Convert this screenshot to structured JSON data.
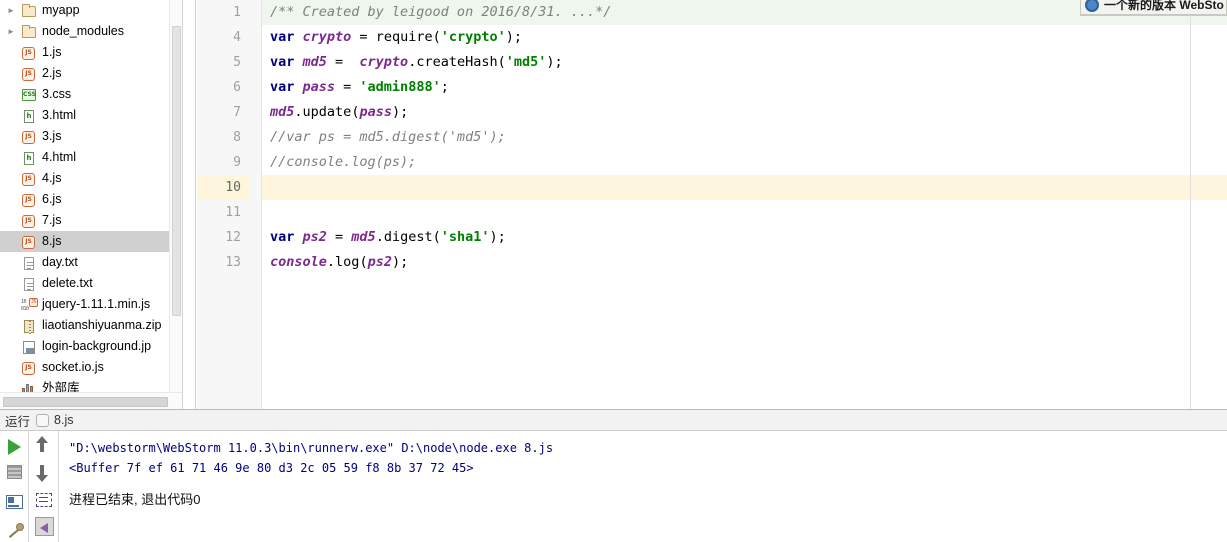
{
  "project_tree": {
    "name": "project-file-tree",
    "items": [
      {
        "label": "myapp",
        "icon": "folder-icon",
        "type": "folder",
        "arrow": "collapsed",
        "selected": false
      },
      {
        "label": "node_modules",
        "icon": "folder-icon",
        "type": "folder",
        "arrow": "collapsed",
        "selected": false
      },
      {
        "label": "1.js",
        "icon": "js-file-icon",
        "type": "js",
        "arrow": "none",
        "selected": false
      },
      {
        "label": "2.js",
        "icon": "js-file-icon",
        "type": "js",
        "arrow": "none",
        "selected": false
      },
      {
        "label": "3.css",
        "icon": "css-file-icon",
        "type": "css",
        "arrow": "none",
        "selected": false
      },
      {
        "label": "3.html",
        "icon": "html-file-icon",
        "type": "html",
        "arrow": "none",
        "selected": false
      },
      {
        "label": "3.js",
        "icon": "js-file-icon",
        "type": "js",
        "arrow": "none",
        "selected": false
      },
      {
        "label": "4.html",
        "icon": "html-file-icon",
        "type": "html",
        "arrow": "none",
        "selected": false
      },
      {
        "label": "4.js",
        "icon": "js-file-icon",
        "type": "js",
        "arrow": "none",
        "selected": false
      },
      {
        "label": "6.js",
        "icon": "js-file-icon",
        "type": "js",
        "arrow": "none",
        "selected": false
      },
      {
        "label": "7.js",
        "icon": "js-file-icon",
        "type": "js",
        "arrow": "none",
        "selected": false
      },
      {
        "label": "8.js",
        "icon": "js-file-icon",
        "type": "js",
        "arrow": "none",
        "selected": true
      },
      {
        "label": "day.txt",
        "icon": "text-file-icon",
        "type": "txt",
        "arrow": "none",
        "selected": false
      },
      {
        "label": "delete.txt",
        "icon": "text-file-icon",
        "type": "txt",
        "arrow": "none",
        "selected": false
      },
      {
        "label": "jquery-1.11.1.min.js",
        "icon": "minified-js-file-icon",
        "type": "minjs",
        "arrow": "none",
        "selected": false
      },
      {
        "label": "liaotianshiyuanma.zip",
        "icon": "zip-file-icon",
        "type": "zip",
        "arrow": "none",
        "selected": false
      },
      {
        "label": "login-background.jp",
        "icon": "image-file-icon",
        "type": "img",
        "arrow": "none",
        "selected": false
      },
      {
        "label": "socket.io.js",
        "icon": "js-file-icon",
        "type": "js",
        "arrow": "none",
        "selected": false
      },
      {
        "label": "外部库",
        "icon": "library-icon",
        "type": "lib",
        "arrow": "none",
        "selected": false
      }
    ]
  },
  "editor": {
    "name": "code-editor",
    "gutter_numbers": [
      "1",
      "4",
      "5",
      "6",
      "7",
      "8",
      "9",
      "10",
      "11",
      "12",
      "13"
    ],
    "caret_line": "10",
    "lines": [
      {
        "number": "1",
        "highlight": "comment",
        "fold": "plus",
        "tokens": [
          {
            "t": "/** Created by leigood on 2016/8/31. ...*/",
            "c": "comment"
          }
        ]
      },
      {
        "number": "4",
        "highlight": "none",
        "fold": "none",
        "tokens": [
          {
            "t": "var ",
            "c": "kw"
          },
          {
            "t": "crypto",
            "c": "localv"
          },
          {
            "t": " = ",
            "c": "plain"
          },
          {
            "t": "require",
            "c": "fn"
          },
          {
            "t": "(",
            "c": "plain"
          },
          {
            "t": "'crypto'",
            "c": "str"
          },
          {
            "t": ");",
            "c": "plain"
          }
        ]
      },
      {
        "number": "5",
        "highlight": "none",
        "fold": "none",
        "tokens": [
          {
            "t": "var ",
            "c": "kw"
          },
          {
            "t": "md5",
            "c": "localv"
          },
          {
            "t": " =  ",
            "c": "plain"
          },
          {
            "t": "crypto",
            "c": "localv"
          },
          {
            "t": ".",
            "c": "plain"
          },
          {
            "t": "createHash",
            "c": "fn"
          },
          {
            "t": "(",
            "c": "plain"
          },
          {
            "t": "'md5'",
            "c": "str"
          },
          {
            "t": ");",
            "c": "plain"
          }
        ]
      },
      {
        "number": "6",
        "highlight": "none",
        "fold": "none",
        "tokens": [
          {
            "t": "var ",
            "c": "kw"
          },
          {
            "t": "pass",
            "c": "localv"
          },
          {
            "t": " = ",
            "c": "plain"
          },
          {
            "t": "'admin888'",
            "c": "str"
          },
          {
            "t": ";",
            "c": "plain"
          }
        ]
      },
      {
        "number": "7",
        "highlight": "none",
        "fold": "none",
        "tokens": [
          {
            "t": "md5",
            "c": "localv"
          },
          {
            "t": ".",
            "c": "plain"
          },
          {
            "t": "update",
            "c": "fn"
          },
          {
            "t": "(",
            "c": "plain"
          },
          {
            "t": "pass",
            "c": "localv"
          },
          {
            "t": ");",
            "c": "plain"
          }
        ]
      },
      {
        "number": "8",
        "highlight": "none",
        "fold": "minus",
        "tokens": [
          {
            "t": "//var ps = md5.digest('md5');",
            "c": "comment"
          }
        ]
      },
      {
        "number": "9",
        "highlight": "none",
        "fold": "minus",
        "tokens": [
          {
            "t": "//console.log(ps);",
            "c": "comment"
          }
        ]
      },
      {
        "number": "10",
        "highlight": "caret",
        "fold": "none",
        "tokens": []
      },
      {
        "number": "11",
        "highlight": "none",
        "fold": "none",
        "tokens": []
      },
      {
        "number": "12",
        "highlight": "none",
        "fold": "none",
        "tokens": [
          {
            "t": "var ",
            "c": "kw"
          },
          {
            "t": "ps2",
            "c": "localv"
          },
          {
            "t": " = ",
            "c": "plain"
          },
          {
            "t": "md5",
            "c": "localv"
          },
          {
            "t": ".",
            "c": "plain"
          },
          {
            "t": "digest",
            "c": "fn"
          },
          {
            "t": "(",
            "c": "plain"
          },
          {
            "t": "'sha1'",
            "c": "str"
          },
          {
            "t": ");",
            "c": "plain"
          }
        ]
      },
      {
        "number": "13",
        "highlight": "none",
        "fold": "none",
        "tokens": [
          {
            "t": "console",
            "c": "localv"
          },
          {
            "t": ".",
            "c": "plain"
          },
          {
            "t": "log",
            "c": "fn"
          },
          {
            "t": "(",
            "c": "plain"
          },
          {
            "t": "ps2",
            "c": "localv"
          },
          {
            "t": ");",
            "c": "plain"
          }
        ]
      }
    ]
  },
  "notification": {
    "icon": "update-info-icon",
    "text": "一个新的版本 WebSto"
  },
  "run_panel": {
    "tab_label": "运行",
    "tab_icon": "run-config-icon",
    "tab_file": "8.js",
    "toolbar_left": [
      {
        "name": "rerun-button",
        "icon": "run-icon",
        "label": ""
      },
      {
        "name": "stop-button",
        "icon": "stop-icon",
        "label": ""
      },
      {
        "name": "show-console-button",
        "icon": "console-icon",
        "label": ""
      },
      {
        "name": "pin-tab-button",
        "icon": "pin-icon",
        "label": ""
      }
    ],
    "toolbar_mid": [
      {
        "name": "up-stack-trace-button",
        "icon": "arrow-up-icon",
        "label": ""
      },
      {
        "name": "down-stack-trace-button",
        "icon": "arrow-down-icon",
        "label": ""
      },
      {
        "name": "soft-wrap-button",
        "icon": "soft-wrap-icon",
        "label": ""
      },
      {
        "name": "scroll-to-end-button",
        "icon": "scroll-to-end-icon",
        "label": ""
      }
    ],
    "console_lines": [
      {
        "text": "\"D:\\webstorm\\WebStorm 11.0.3\\bin\\runnerw.exe\" D:\\node\\node.exe 8.js",
        "style": "mono"
      },
      {
        "text": "<Buffer 7f ef 61 71 46 9e 80 d3 2c 05 59 f8 8b 37 72 45>",
        "style": "mono"
      },
      {
        "text": "进程已结束, 退出代码0",
        "style": "cn"
      }
    ]
  },
  "colors": {
    "selection_bg": "#d0d0d0",
    "caret_line_bg": "#fdf6dd",
    "comment_line_bg": "#eef6ee",
    "keyword": "#000080",
    "local_var": "#7d2a8f",
    "string": "#008000",
    "comment": "#808080",
    "console_text": "#00007f",
    "run_green": "#3aa13a"
  }
}
